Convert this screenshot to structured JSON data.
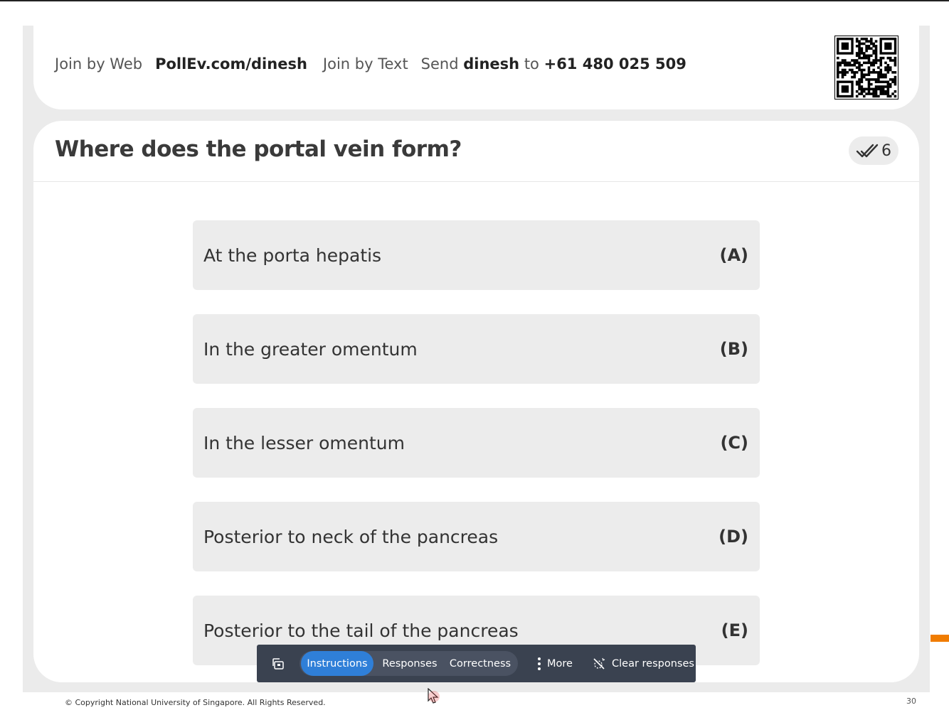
{
  "join": {
    "web_prefix": "Join by Web",
    "web_url": "PollEv.com/dinesh",
    "text_prefix": "Join by Text",
    "send_word": "Send",
    "keyword": "dinesh",
    "to_word": "to",
    "phone": "+61 480 025 509"
  },
  "question": {
    "title": "Where does the portal vein form?",
    "response_count": "6"
  },
  "options": [
    {
      "label": "At the porta hepatis",
      "letter": "(A)"
    },
    {
      "label": "In the greater omentum",
      "letter": "(B)"
    },
    {
      "label": "In the lesser omentum",
      "letter": "(C)"
    },
    {
      "label": "Posterior to neck of the pancreas",
      "letter": "(D)"
    },
    {
      "label": "Posterior to the tail of the pancreas",
      "letter": "(E)"
    }
  ],
  "toolbar": {
    "instructions": "Instructions",
    "responses": "Responses",
    "correctness": "Correctness",
    "more": "More",
    "clear": "Clear responses",
    "active_tab": "Instructions"
  },
  "footer": {
    "copyright": "© Copyright National University of Singapore. All Rights Reserved.",
    "page": "30"
  },
  "colors": {
    "accent": "#2f7fd8",
    "toolbar_bg": "#3a4250",
    "option_bg": "#ececec",
    "slide_bg": "#ebebeb",
    "orange": "#f07c00"
  },
  "icons": [
    "checkmarks-icon",
    "qr-code-icon",
    "present-icon",
    "more-vertical-icon",
    "clear-icon",
    "mouse-cursor-icon"
  ]
}
